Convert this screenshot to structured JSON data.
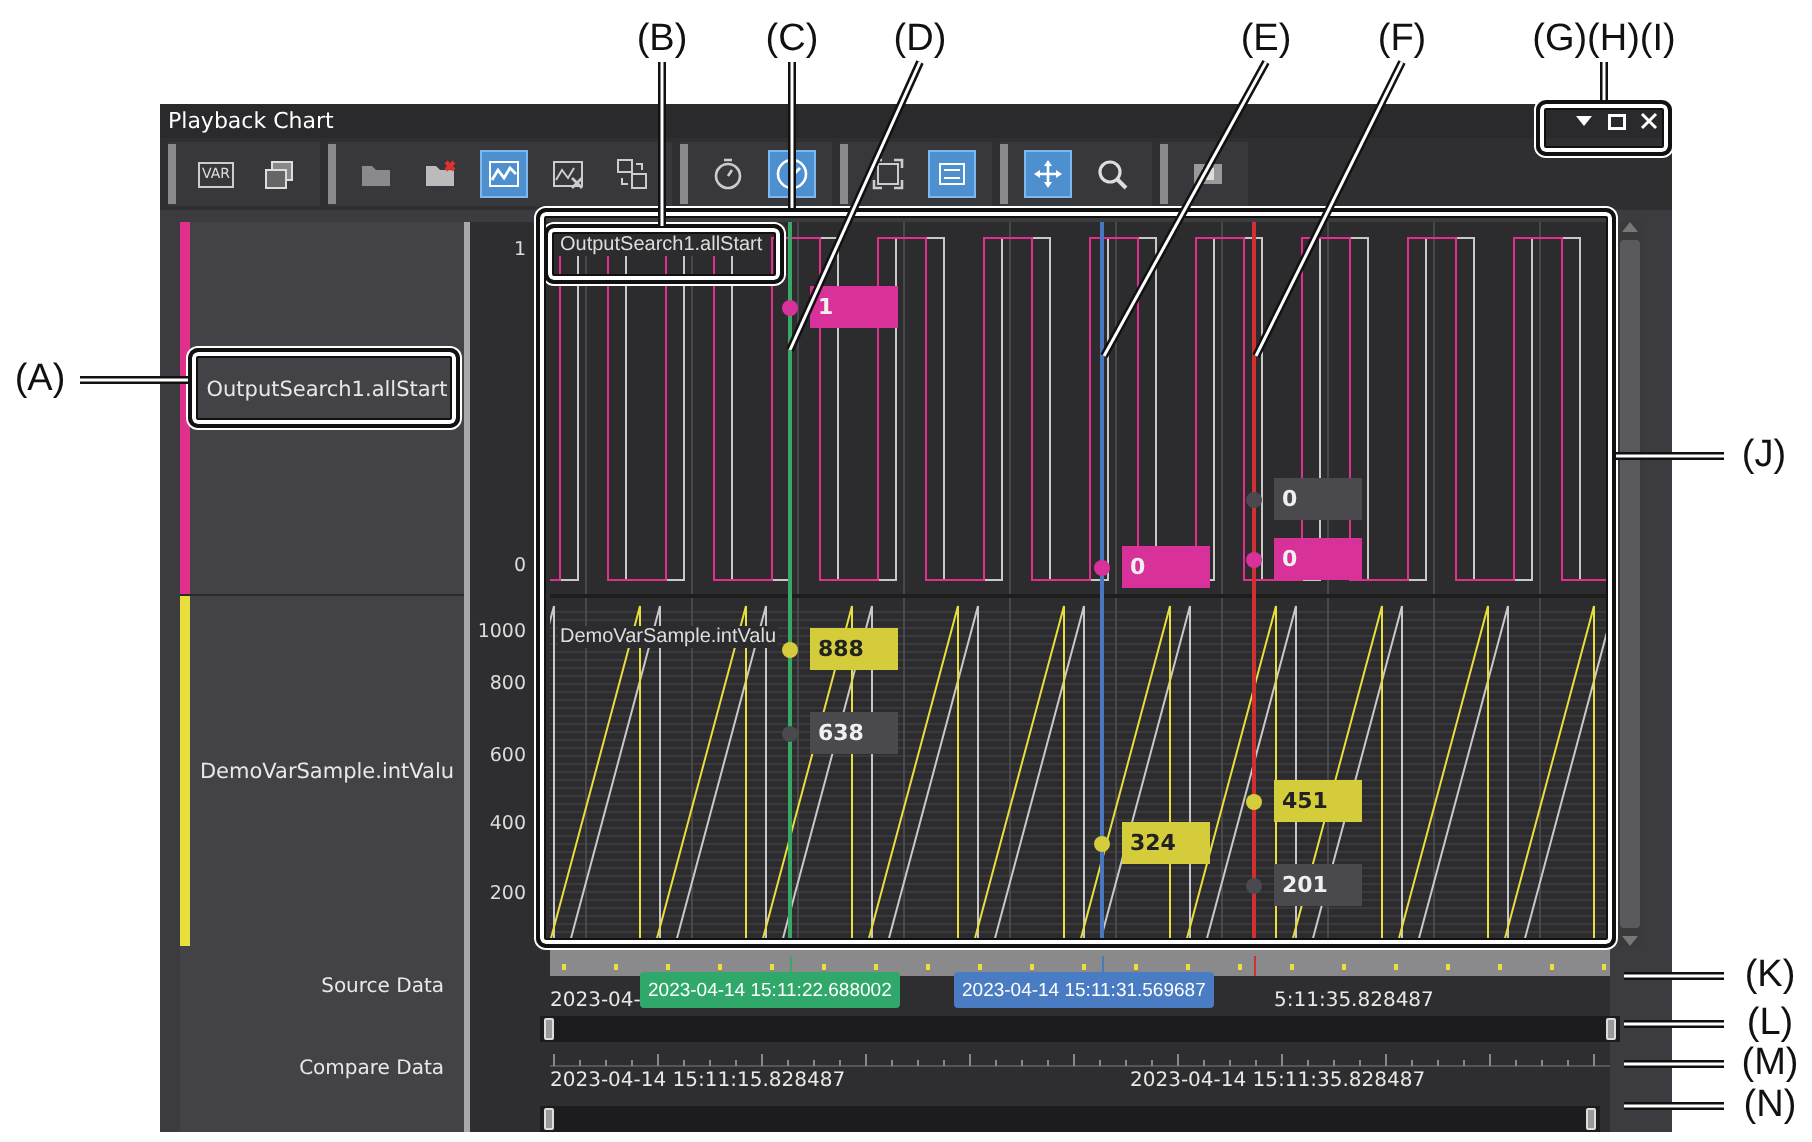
{
  "callouts": [
    {
      "label": "(A)"
    },
    {
      "label": "(B)"
    },
    {
      "label": "(C)"
    },
    {
      "label": "(D)"
    },
    {
      "label": "(E)"
    },
    {
      "label": "(F)"
    },
    {
      "label": "(G)(H)(I)"
    },
    {
      "label": "(J)"
    },
    {
      "label": "(K)"
    },
    {
      "label": "(L)"
    },
    {
      "label": "(M)"
    },
    {
      "label": "(N)"
    }
  ],
  "window": {
    "title": "Playback Chart"
  },
  "toolbar": {
    "groups": [
      {
        "buttons": [
          {
            "label": "VAR",
            "selected": false
          },
          {
            "selected": false
          }
        ]
      },
      {
        "buttons": [
          {
            "selected": false
          },
          {
            "selected": false
          },
          {
            "selected": true
          },
          {
            "selected": false
          },
          {
            "selected": false
          }
        ]
      },
      {
        "buttons": [
          {
            "selected": false
          },
          {
            "selected": true
          }
        ]
      },
      {
        "buttons": [
          {
            "selected": false
          },
          {
            "selected": true
          }
        ]
      },
      {
        "buttons": [
          {
            "selected": true
          },
          {
            "selected": false
          }
        ]
      },
      {
        "buttons": [
          {
            "selected": false
          }
        ]
      }
    ]
  },
  "signals": [
    {
      "name": "OutputSearch1.allStart",
      "color": "#e0308c",
      "chart_label": "OutputSearch1.allStart",
      "axis_labels": [
        "1",
        "0"
      ]
    },
    {
      "name": "DemoVarSample.intValu",
      "color": "#e8de3c",
      "chart_label": "DemoVarSample.intValu",
      "axis_labels": [
        "1000",
        "800",
        "600",
        "400",
        "200"
      ]
    }
  ],
  "cursors": [
    {
      "color": "#3aa865",
      "readouts": [
        {
          "text": "1",
          "color": "#d8329a"
        },
        {
          "text": "888",
          "color": "#d4cc3a"
        },
        {
          "text": "638",
          "color": "#4a4a4e"
        }
      ]
    },
    {
      "color": "#4a78c0",
      "readouts": [
        {
          "text": "0",
          "color": "#d8329a"
        },
        {
          "text": "324",
          "color": "#d4cc3a"
        }
      ]
    },
    {
      "color": "#d03030",
      "readouts": [
        {
          "text": "0",
          "color": "#4a4a4e"
        },
        {
          "text": "0",
          "color": "#d8329a"
        },
        {
          "text": "451",
          "color": "#d4cc3a"
        },
        {
          "text": "201",
          "color": "#4a4a4e"
        }
      ]
    }
  ],
  "source_data": {
    "label": "Source Data",
    "slider": {
      "level": 1
    },
    "start": "2023-04-",
    "end": "5:11:35.828487",
    "flags": [
      {
        "text": "2023-04-14 15:11:22.688002",
        "color": "#2fa86a"
      },
      {
        "text": "2023-04-14 15:11:31.569687",
        "color": "#4a7cc4"
      }
    ]
  },
  "compare_data": {
    "label": "Compare Data",
    "slider": {
      "level": 1
    },
    "start": "2023-04-14 15:11:15.828487",
    "end": "2023-04-14 15:11:35.828487"
  }
}
